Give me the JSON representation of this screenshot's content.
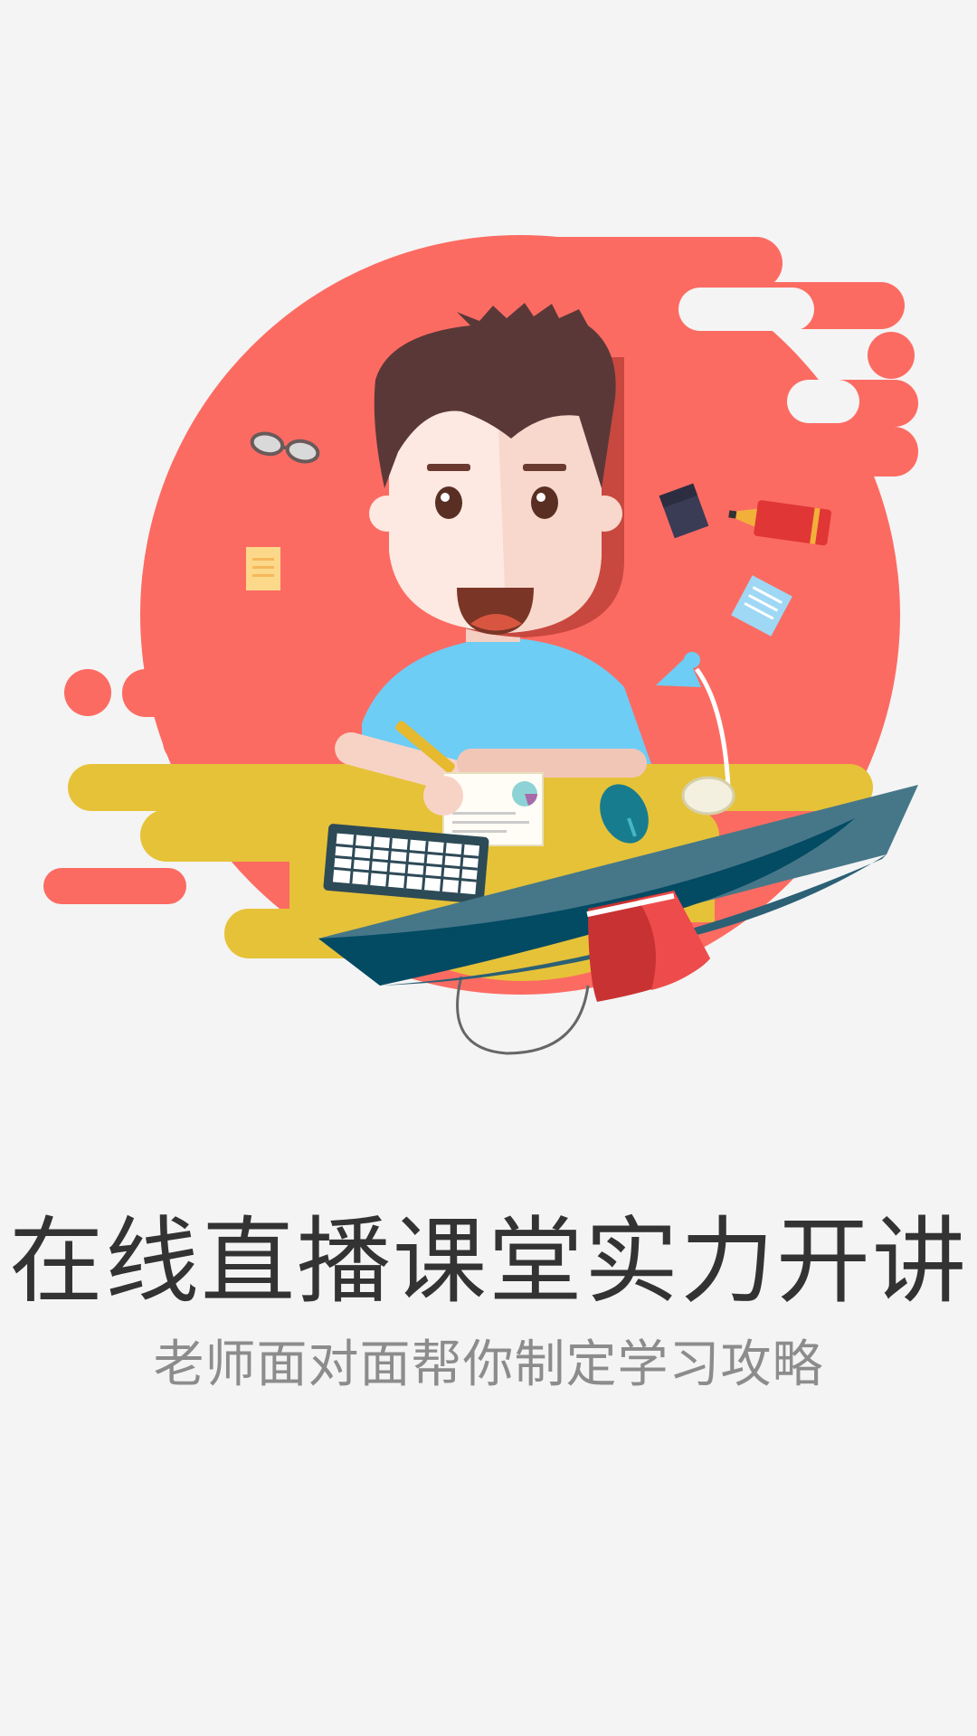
{
  "headline": "在线直播课堂实力开讲",
  "subline": "老师面对面帮你制定学习攻略",
  "colors": {
    "background": "#f4f4f4",
    "accent_red": "#fc6b62",
    "accent_yellow": "#e6c238",
    "headline_text": "#333333",
    "subline_text": "#8c8c8c"
  },
  "illustration": {
    "icons": [
      "glasses-icon",
      "sticky-note-icon",
      "notebook-icon",
      "marker-icon",
      "notepad-icon",
      "desk-lamp-icon",
      "keyboard-icon",
      "mouse-icon",
      "monitor-icon",
      "book-icon"
    ]
  }
}
